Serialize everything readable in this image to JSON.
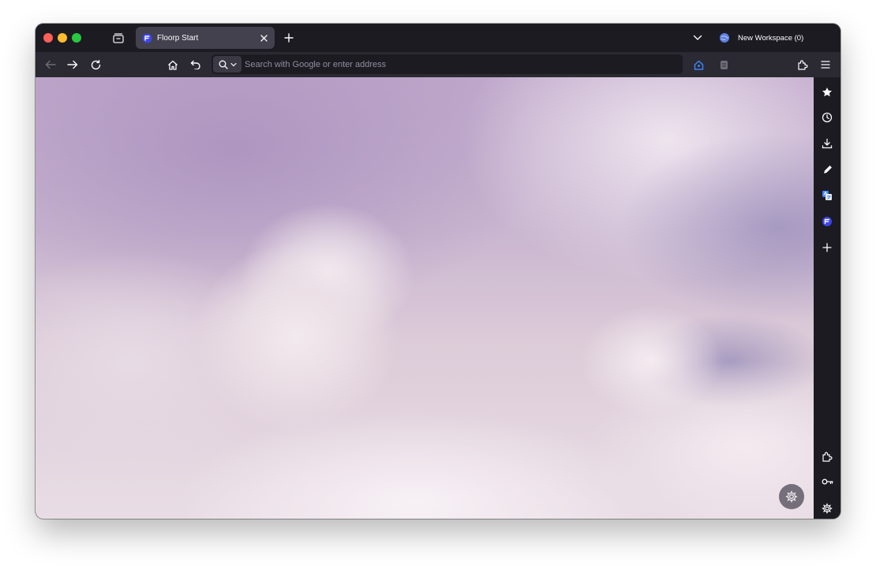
{
  "tab": {
    "title": "Floorp Start",
    "favicon": "floorp-logo-icon"
  },
  "workspace": {
    "label": "New Workspace (0)",
    "icon": "globe-icon"
  },
  "urlbar": {
    "placeholder": "Search with Google or enter address"
  },
  "toolbar": {
    "buttons": [
      "back-icon",
      "forward-icon",
      "reload-icon",
      "home-icon",
      "undo-close-tab-icon",
      "search-engine-icon",
      "extensions-icon",
      "menu-icon"
    ]
  },
  "sidebar": {
    "top": [
      "bookmarks-star-icon",
      "history-icon",
      "downloads-icon",
      "notes-pencil-icon",
      "translate-icon",
      "floorp-logo-icon",
      "add-panel-icon"
    ],
    "bottom": [
      "extensions-icon",
      "passwords-key-icon",
      "settings-gear-icon"
    ]
  },
  "colors": {
    "titlebar": "#1c1b22",
    "navbar": "#2b2a33",
    "active_tab": "#42414d",
    "accent_blue": "#3b82f6",
    "wallpaper_top": "#c0a8cb",
    "wallpaper_bottom": "#e9dde5"
  }
}
